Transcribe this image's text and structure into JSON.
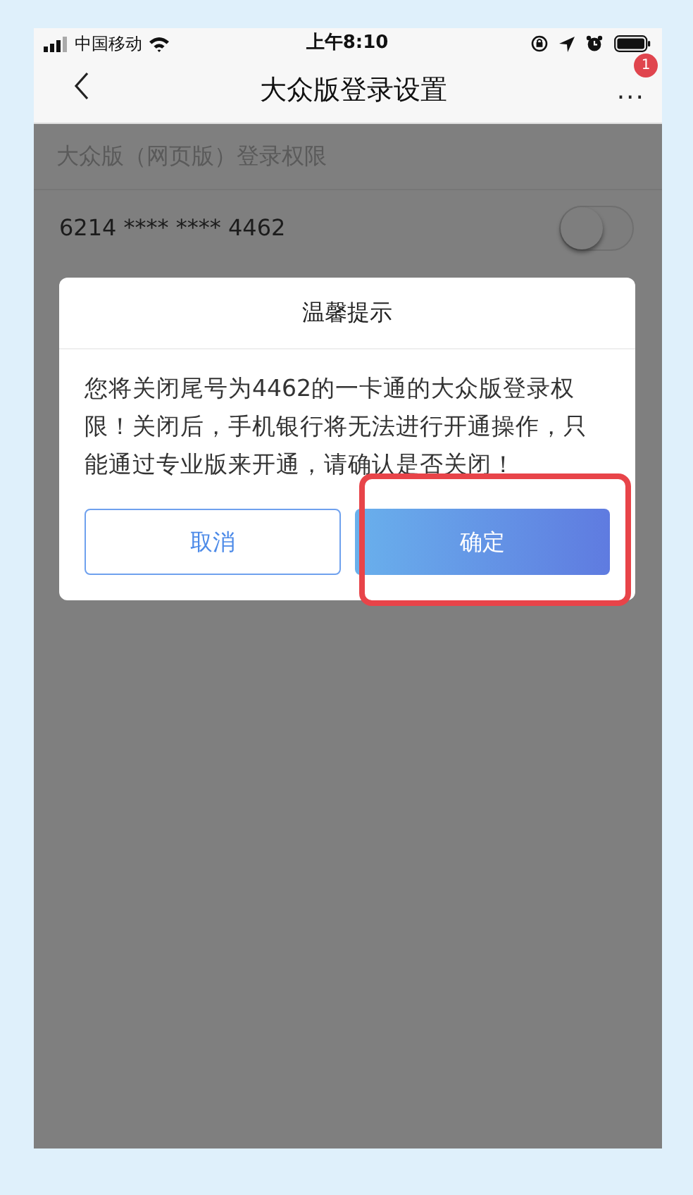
{
  "status_bar": {
    "carrier": "中国移动",
    "time": "上午8:10"
  },
  "nav": {
    "title": "大众版登录设置",
    "more": "...",
    "badge": "1"
  },
  "section": {
    "title": "大众版（网页版）登录权限"
  },
  "accounts": [
    {
      "number": "6214 **** **** 4462",
      "on": false
    }
  ],
  "dialog": {
    "title": "温馨提示",
    "message": "您将关闭尾号为4462的一卡通的大众版登录权限！关闭后，手机银行将无法进行开通操作，只能通过专业版来开通，请确认是否关闭！",
    "buttons": [
      {
        "label": "取消",
        "kind": "outline",
        "highlighted": false
      },
      {
        "label": "确定",
        "kind": "primary",
        "highlighted": true
      }
    ]
  }
}
